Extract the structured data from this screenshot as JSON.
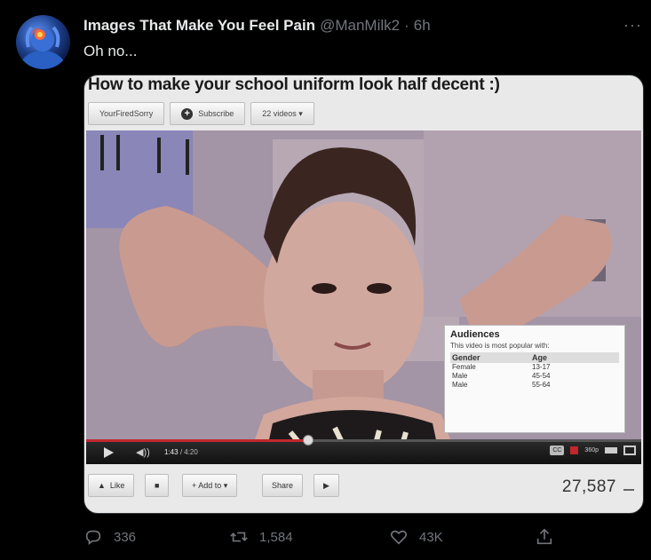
{
  "tweet": {
    "display_name": "Images That Make You Feel Pain",
    "handle": "@ManMilk2",
    "dot": "·",
    "time": "6h",
    "more": "···",
    "text": "Oh no..."
  },
  "media": {
    "video_title": "How to make your school uniform look half decent :)",
    "top_bar": {
      "channel": "YourFiredSorry",
      "subscribe": "Subscribe",
      "videos": "22 videos ▾"
    },
    "audiences": {
      "title": "Audiences",
      "subtitle": "This video is most popular with:",
      "col_gender": "Gender",
      "col_age": "Age",
      "rows": [
        {
          "gender": "Female",
          "age": "13-17"
        },
        {
          "gender": "Male",
          "age": "45-54"
        },
        {
          "gender": "Male",
          "age": "55-64"
        }
      ]
    },
    "player": {
      "current_time": "1:43",
      "total_time": "/ 4:20",
      "progress": 0.4,
      "cc": "CC",
      "quality": "360p"
    },
    "bottom_bar": {
      "like": "Like",
      "add_to": "+ Add to ▾",
      "share": "Share",
      "views": "27,587"
    }
  },
  "actions": {
    "replies": "336",
    "retweets": "1,584",
    "likes": "43K"
  },
  "colors": {
    "background": "#000000",
    "text_primary": "#e7e9ea",
    "text_secondary": "#71767b",
    "youtube_red": "#c0282d"
  },
  "icons": [
    "reply-icon",
    "retweet-icon",
    "like-icon",
    "share-icon",
    "more-icon",
    "play-icon",
    "volume-icon",
    "subscribe-plus-icon",
    "thumbs-up-icon",
    "flag-icon"
  ]
}
